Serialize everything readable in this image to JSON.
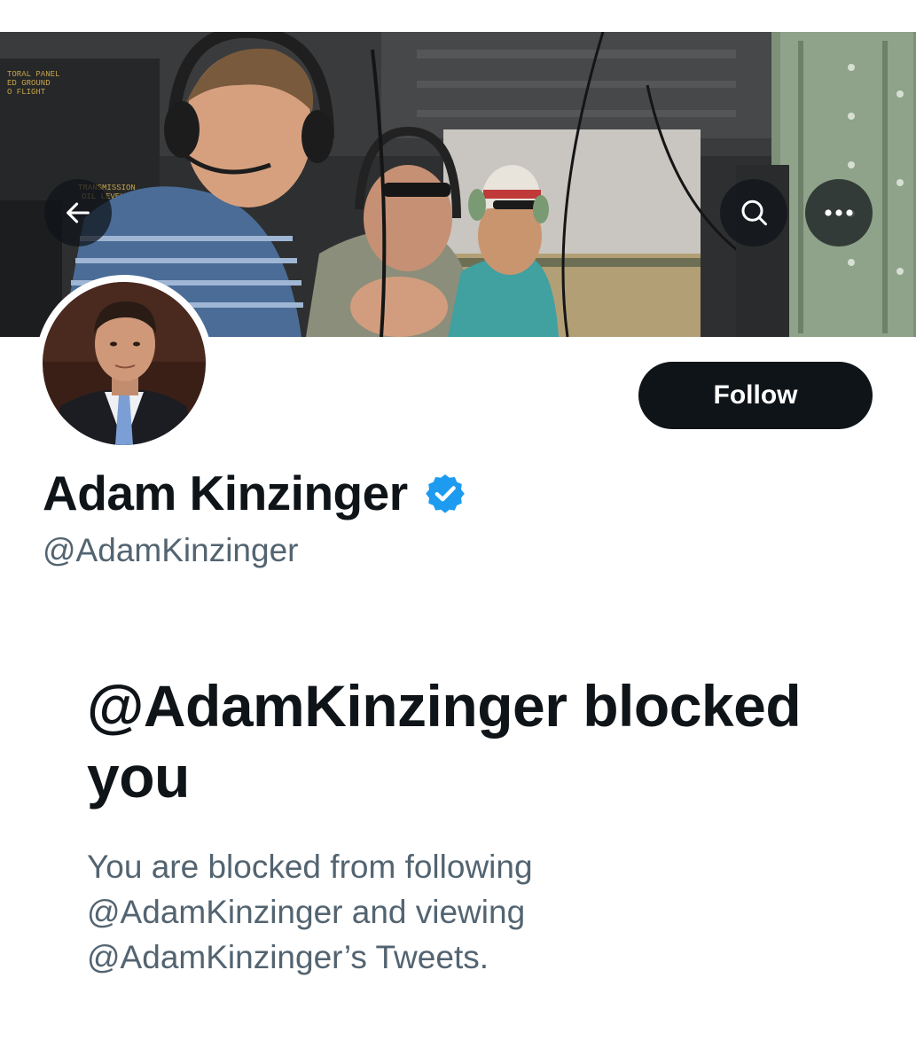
{
  "profile": {
    "display_name": "Adam Kinzinger",
    "handle": "@AdamKinzinger",
    "verified": true,
    "verified_badge_color": "#1d9bf0"
  },
  "header": {
    "back_icon": "arrow-left-icon",
    "search_icon": "search-icon",
    "more_icon": "more-horizontal-icon",
    "banner_panel_text": [
      "TORAL PANEL",
      "ED GROUND",
      "O FLIGHT"
    ],
    "banner_plate_text": [
      "TRANSMISSION",
      "OIL LEVEL"
    ]
  },
  "actions": {
    "follow_label": "Follow"
  },
  "blocked": {
    "title": "@AdamKinzinger blocked you",
    "description": "You are blocked from following @AdamKinzinger and viewing @AdamKinzinger’s Tweets."
  },
  "colors": {
    "primary_text": "#0f1419",
    "secondary_text": "#536471",
    "button_bg": "#0f1419",
    "button_text": "#ffffff"
  }
}
